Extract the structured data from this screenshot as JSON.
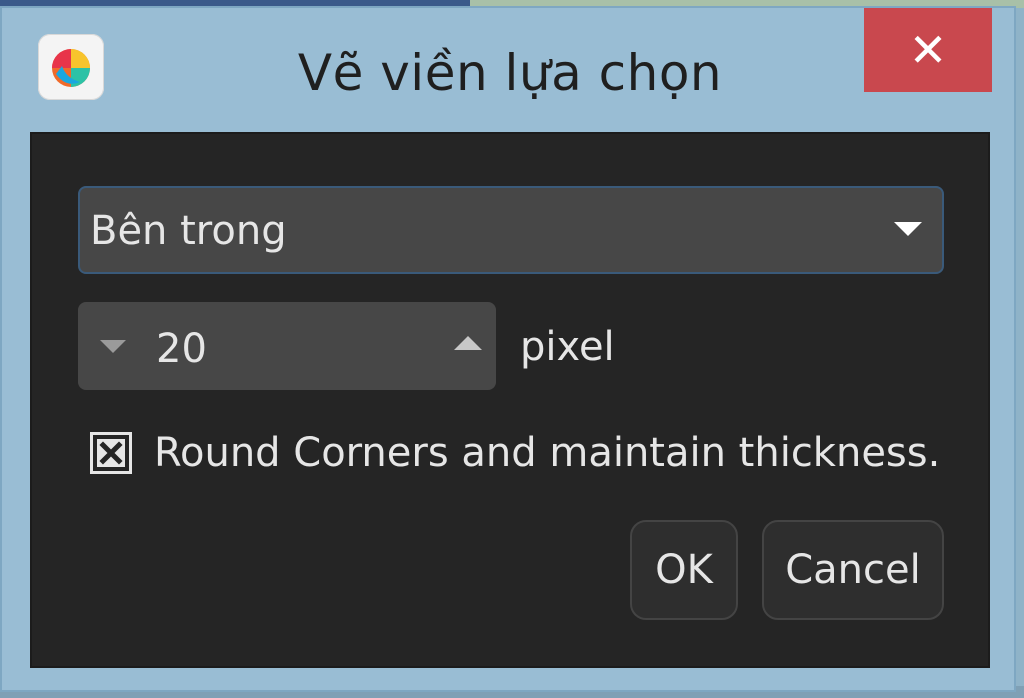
{
  "window": {
    "title": "Vẽ viền lựa chọn",
    "close_symbol": "✕",
    "app_icon": "medibang-paint-logo-icon"
  },
  "dialog": {
    "border_position": {
      "selected": "Bên trong"
    },
    "width": {
      "value": "20",
      "unit": "pixel"
    },
    "round_corners": {
      "checked": true,
      "label": "Round Corners and maintain thickness."
    },
    "buttons": {
      "ok": "OK",
      "cancel": "Cancel"
    }
  },
  "colors": {
    "titlebar": "#99bdd4",
    "close": "#c9484e",
    "panel": "#252525",
    "field": "#474747",
    "text": "#e6e6e6"
  }
}
